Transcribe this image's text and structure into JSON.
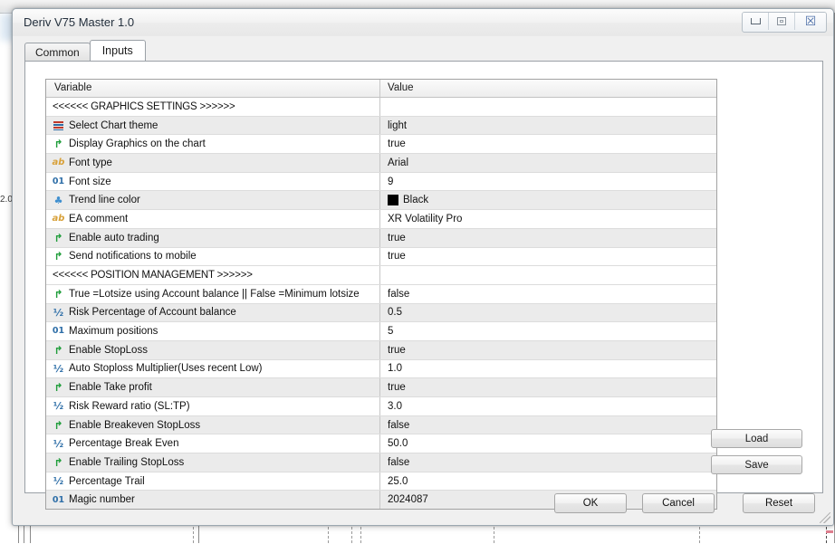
{
  "window": {
    "title": "Deriv V75 Master 1.0",
    "controls": {
      "minimize": "minimize-button",
      "maximize": "maximize-button",
      "close": "☒"
    }
  },
  "tabs": [
    {
      "label": "Common",
      "active": false
    },
    {
      "label": "Inputs",
      "active": true
    }
  ],
  "grid": {
    "headers": {
      "variable": "Variable",
      "value": "Value"
    },
    "rows": [
      {
        "type": "section",
        "icon": "",
        "variable": "<<<<<< GRAPHICS SETTINGS >>>>>>",
        "value": ""
      },
      {
        "type": "enum",
        "icon": "enum",
        "variable": "Select Chart theme",
        "value": "light"
      },
      {
        "type": "bool",
        "icon": "bool",
        "variable": "Display Graphics on the chart",
        "value": "true"
      },
      {
        "type": "string",
        "icon": "string",
        "variable": "Font type",
        "value": "Arial"
      },
      {
        "type": "int",
        "icon": "int",
        "variable": "Font size",
        "value": "9"
      },
      {
        "type": "color",
        "icon": "color",
        "variable": "Trend line color",
        "value": "Black",
        "swatch": "#000000"
      },
      {
        "type": "string",
        "icon": "string",
        "variable": "EA comment",
        "value": "XR Volatility Pro"
      },
      {
        "type": "bool",
        "icon": "bool",
        "variable": "Enable auto trading",
        "value": "true"
      },
      {
        "type": "bool",
        "icon": "bool",
        "variable": "Send notifications to mobile",
        "value": "true"
      },
      {
        "type": "section",
        "icon": "",
        "variable": "<<<<<< POSITION MANAGEMENT >>>>>>",
        "value": ""
      },
      {
        "type": "bool",
        "icon": "bool",
        "variable": "True =Lotsize using Account balance || False =Minimum lotsize",
        "value": "false"
      },
      {
        "type": "double",
        "icon": "double",
        "variable": "Risk Percentage of Account balance",
        "value": "0.5"
      },
      {
        "type": "int",
        "icon": "int",
        "variable": "Maximum positions",
        "value": "5"
      },
      {
        "type": "bool",
        "icon": "bool",
        "variable": "Enable StopLoss",
        "value": "true"
      },
      {
        "type": "double",
        "icon": "double",
        "variable": "Auto Stoploss Multiplier(Uses recent Low)",
        "value": "1.0"
      },
      {
        "type": "bool",
        "icon": "bool",
        "variable": "Enable Take profit",
        "value": "true"
      },
      {
        "type": "double",
        "icon": "double",
        "variable": "Risk Reward ratio (SL:TP)",
        "value": "3.0"
      },
      {
        "type": "bool",
        "icon": "bool",
        "variable": "Enable Breakeven StopLoss",
        "value": "false"
      },
      {
        "type": "double",
        "icon": "double",
        "variable": "Percentage Break Even",
        "value": "50.0"
      },
      {
        "type": "bool",
        "icon": "bool",
        "variable": "Enable Trailing StopLoss",
        "value": "false"
      },
      {
        "type": "double",
        "icon": "double",
        "variable": "Percentage Trail",
        "value": "25.0"
      },
      {
        "type": "int",
        "icon": "int",
        "variable": "Magic number",
        "value": "2024087"
      }
    ]
  },
  "side_buttons": {
    "load": "Load",
    "save": "Save"
  },
  "dialog_buttons": {
    "ok": "OK",
    "cancel": "Cancel",
    "reset": "Reset"
  },
  "background": {
    "y_tick": "2.0"
  },
  "icon_glyphs": {
    "bool": "↱",
    "string": "ab",
    "int": "01",
    "double": "½",
    "color": "♣"
  }
}
